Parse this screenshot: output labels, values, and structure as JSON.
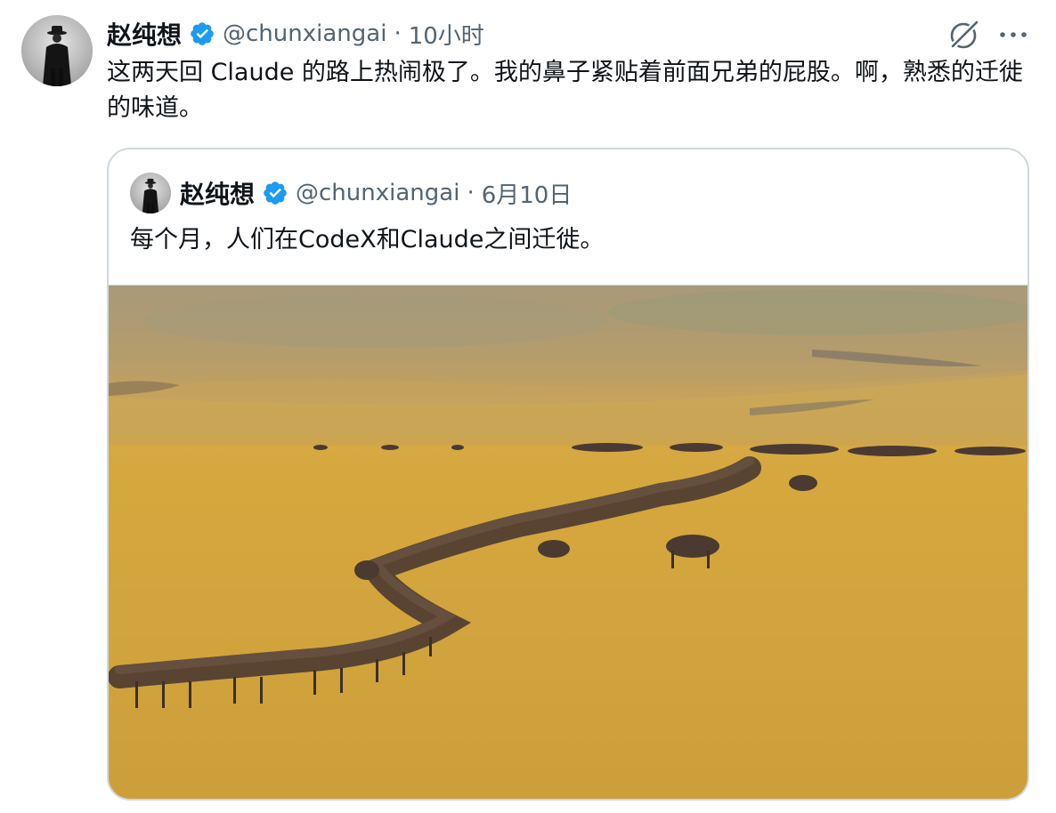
{
  "tweet": {
    "author_name": "赵纯想",
    "author_handle": "@chunxiangai",
    "separator": "·",
    "timestamp": "10小时",
    "text": "这两天回 Claude 的路上热闹极了。我的鼻子紧贴着前面兄弟的屁股。啊，熟悉的迁徙的味道。",
    "verified": true
  },
  "quoted_tweet": {
    "author_name": "赵纯想",
    "author_handle": "@chunxiangai",
    "separator": "·",
    "timestamp": "6月10日",
    "text": "每个月，人们在CodeX和Claude之间迁徙。",
    "verified": true,
    "media": {
      "type": "photo",
      "icon": "wildebeest-migration-photo"
    }
  },
  "icons": {
    "verified": "verified-badge-icon",
    "grok": "grok-icon",
    "more": "more-options-icon"
  },
  "colors": {
    "text": "#0f1419",
    "secondary": "#536471",
    "verified_blue": "#1d9bf0",
    "border": "#cfd9de"
  }
}
